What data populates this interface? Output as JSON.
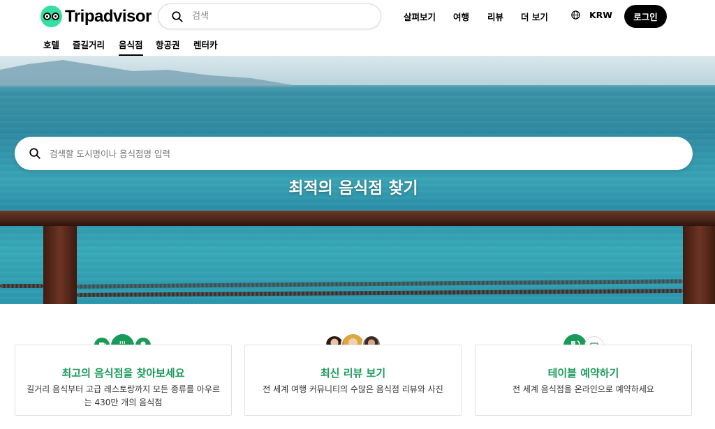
{
  "header": {
    "logo_text": "Tripadvisor",
    "search_placeholder": "검색",
    "nav": [
      "살펴보기",
      "여행",
      "리뷰",
      "더 보기"
    ],
    "currency": "KRW",
    "login_label": "로그인"
  },
  "category_tabs": [
    {
      "label": "호텔",
      "active": false
    },
    {
      "label": "즐길거리",
      "active": false
    },
    {
      "label": "음식점",
      "active": true
    },
    {
      "label": "항공권",
      "active": false
    },
    {
      "label": "렌터카",
      "active": false
    }
  ],
  "hero": {
    "search_placeholder": "검색할 도시명이나 음식점명 입력",
    "title": "최적의 음식점 찾기"
  },
  "cards": [
    {
      "title": "최고의  음식점을 찾아보세요",
      "desc": "길거리 음식부터 고급 레스토랑까지 모든 종류를 아우르는 430만 개의 음식점",
      "icons": [
        "drink-icon",
        "coffee-icon",
        "ice-cream-icon"
      ]
    },
    {
      "title": "최신 리뷰 보기",
      "desc": "전 세계 여행 커뮤니티의 수많은 음식점 리뷰와 사진",
      "icons": [
        "reviewer-avatar",
        "reviewer-avatar",
        "reviewer-avatar"
      ]
    },
    {
      "title": "테이블 예약하기",
      "desc": "전 세계 음식점을 온라인으로 예약하세요",
      "icons": [
        "fork-knife-icon",
        "calendar-icon"
      ]
    }
  ],
  "colors": {
    "brand_green": "#34e0a1",
    "accent_green": "#1a9a5a",
    "login_bg": "#000000"
  }
}
